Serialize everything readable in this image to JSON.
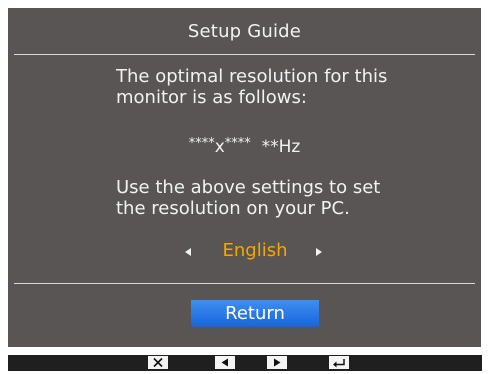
{
  "dialog": {
    "title": "Setup Guide",
    "message_line1": "The optimal resolution for this",
    "message_line2": "monitor is as follows:",
    "resolution_width": "****",
    "resolution_x": "x",
    "resolution_height": "****",
    "refresh_rate": "**Hz",
    "instruction_line1": "Use the above settings to set",
    "instruction_line2": "the resolution on your PC.",
    "language": "English",
    "return_label": "Return"
  },
  "colors": {
    "panel_background": "#585554",
    "text": "#f2f2f2",
    "language_highlight": "#f5a800",
    "button_blue": "#1e6fe0",
    "keybar_background": "#1f1f1f"
  },
  "keybar": {
    "keys": [
      "close-icon",
      "left-arrow-icon",
      "right-arrow-icon",
      "enter-icon"
    ]
  }
}
